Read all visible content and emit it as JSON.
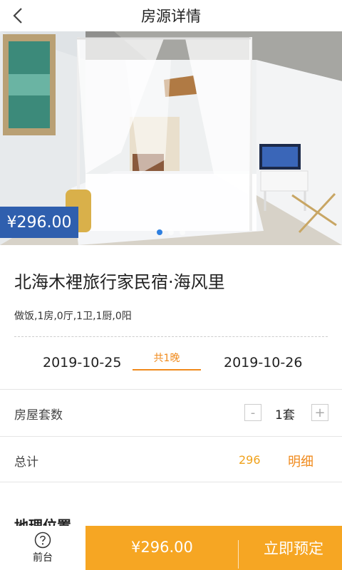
{
  "header": {
    "title": "房源详情",
    "back_icon": "chevron-left-icon"
  },
  "gallery": {
    "price": "¥296.00",
    "slide_count": 3,
    "active_slide": 1
  },
  "listing": {
    "name": "北海木裡旅行家民宿·海风里",
    "tags": "做饭,1房,0厅,1卫,1厨,0阳"
  },
  "dates": {
    "checkin": "2019-10-25",
    "checkout": "2019-10-26",
    "nights": "共1晚"
  },
  "rooms": {
    "label": "房屋套数",
    "minus": "-",
    "quantity": "1套",
    "plus": "+"
  },
  "total": {
    "label": "总计",
    "value": "296",
    "detail_label": "明细"
  },
  "location": {
    "title": "地理位置"
  },
  "bottom_bar": {
    "front_desk_icon": "question-circle-icon",
    "front_desk_label": "前台",
    "price": "¥296.00",
    "book_label": "立即预定"
  },
  "colors": {
    "accent_orange": "#f08a1c",
    "pay_bar": "#f6a623",
    "price_tag": "#2f5fae",
    "active_dot": "#2e7fe0"
  }
}
